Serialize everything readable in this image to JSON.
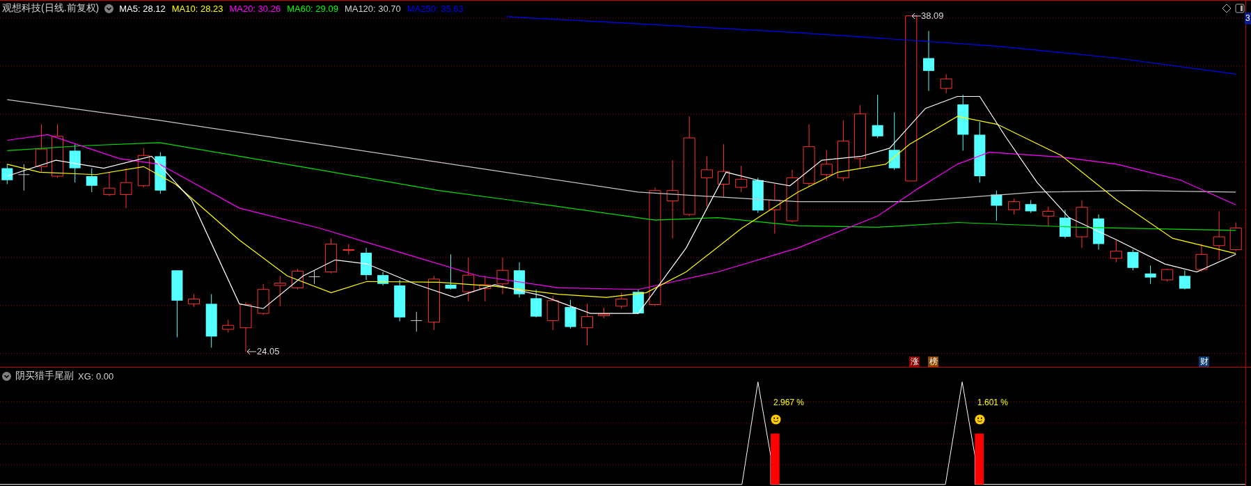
{
  "header": {
    "title": "观想科技(日线.前复权)",
    "ma": [
      {
        "label": "MA5: 28.12",
        "color": "#ffffff"
      },
      {
        "label": "MA10: 28.23",
        "color": "#ffff00"
      },
      {
        "label": "MA20: 30.26",
        "color": "#ff00ff"
      },
      {
        "label": "MA60: 29.09",
        "color": "#00ff00"
      },
      {
        "label": "MA120: 30.70",
        "color": "#d0d0d0"
      },
      {
        "label": "MA250: 35.63",
        "color": "#0000ff"
      }
    ]
  },
  "main_chart": {
    "high_label": "38.09",
    "low_label": "24.05",
    "axis_label": "3",
    "badges": [
      {
        "text": "涨",
        "color": "#8b0000"
      },
      {
        "text": "榜",
        "color": "#8b4500"
      },
      {
        "text": "财",
        "color": "#0b3a6e"
      }
    ]
  },
  "indicator": {
    "title": "阴买猎手尾副",
    "value": "XG: 0.00",
    "signals": [
      {
        "text": "2.967 %"
      },
      {
        "text": "1.601 %"
      }
    ]
  }
}
